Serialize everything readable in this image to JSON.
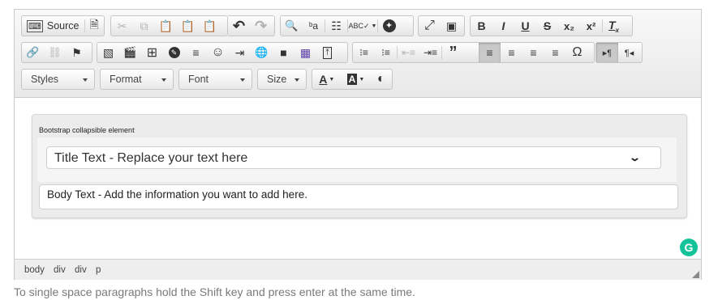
{
  "toolbar": {
    "source_label": "Source",
    "combos": {
      "styles": "Styles",
      "format": "Format",
      "font": "Font",
      "size": "Size"
    },
    "glyphs": {
      "undo": "↶",
      "redo": "↷",
      "find": "🔍",
      "replace": "ᵇa",
      "spellcheck": "ABC✓",
      "accessibility": "✪",
      "maximize": "⤢",
      "showblocks": "▣",
      "bold": "B",
      "italic": "I",
      "underline": "U",
      "strike": "S",
      "subscript": "x₂",
      "superscript": "x²",
      "removeformat": "Tx",
      "link": "🔗",
      "unlink": "⛓",
      "anchor": "⚑",
      "image": "▧",
      "flash": "🎬",
      "table": "⊞",
      "hr": "≡",
      "smiley": "☺",
      "pagebreak": "⇥",
      "iframe": "🌐",
      "templates": "■",
      "gridview": "▦",
      "collapsible": "⤒",
      "numlist": "⒈",
      "bullist": "•≡",
      "outdent": "⇤",
      "indent": "⇥",
      "blockquote": "❞",
      "alignleft": "≡",
      "aligncenter": "≡",
      "alignright": "≡",
      "justify": "≡",
      "specialchar": "Ω",
      "ltr": "▸¶",
      "rtl": "¶◂",
      "textcolor": "A",
      "bgcolor": "A",
      "contrast": "◐"
    }
  },
  "content": {
    "card_label": "Bootstrap collapsible element",
    "title_text": "Title Text - Replace your text here",
    "body_text": "Body Text - Add the information you want to add here."
  },
  "pathbar": [
    "body",
    "div",
    "div",
    "p"
  ],
  "hint": "To single space paragraphs hold the Shift key and press enter at the same time.",
  "colors": {
    "grammarly": "#15c39a",
    "toolbar_bg": "#ececec"
  }
}
